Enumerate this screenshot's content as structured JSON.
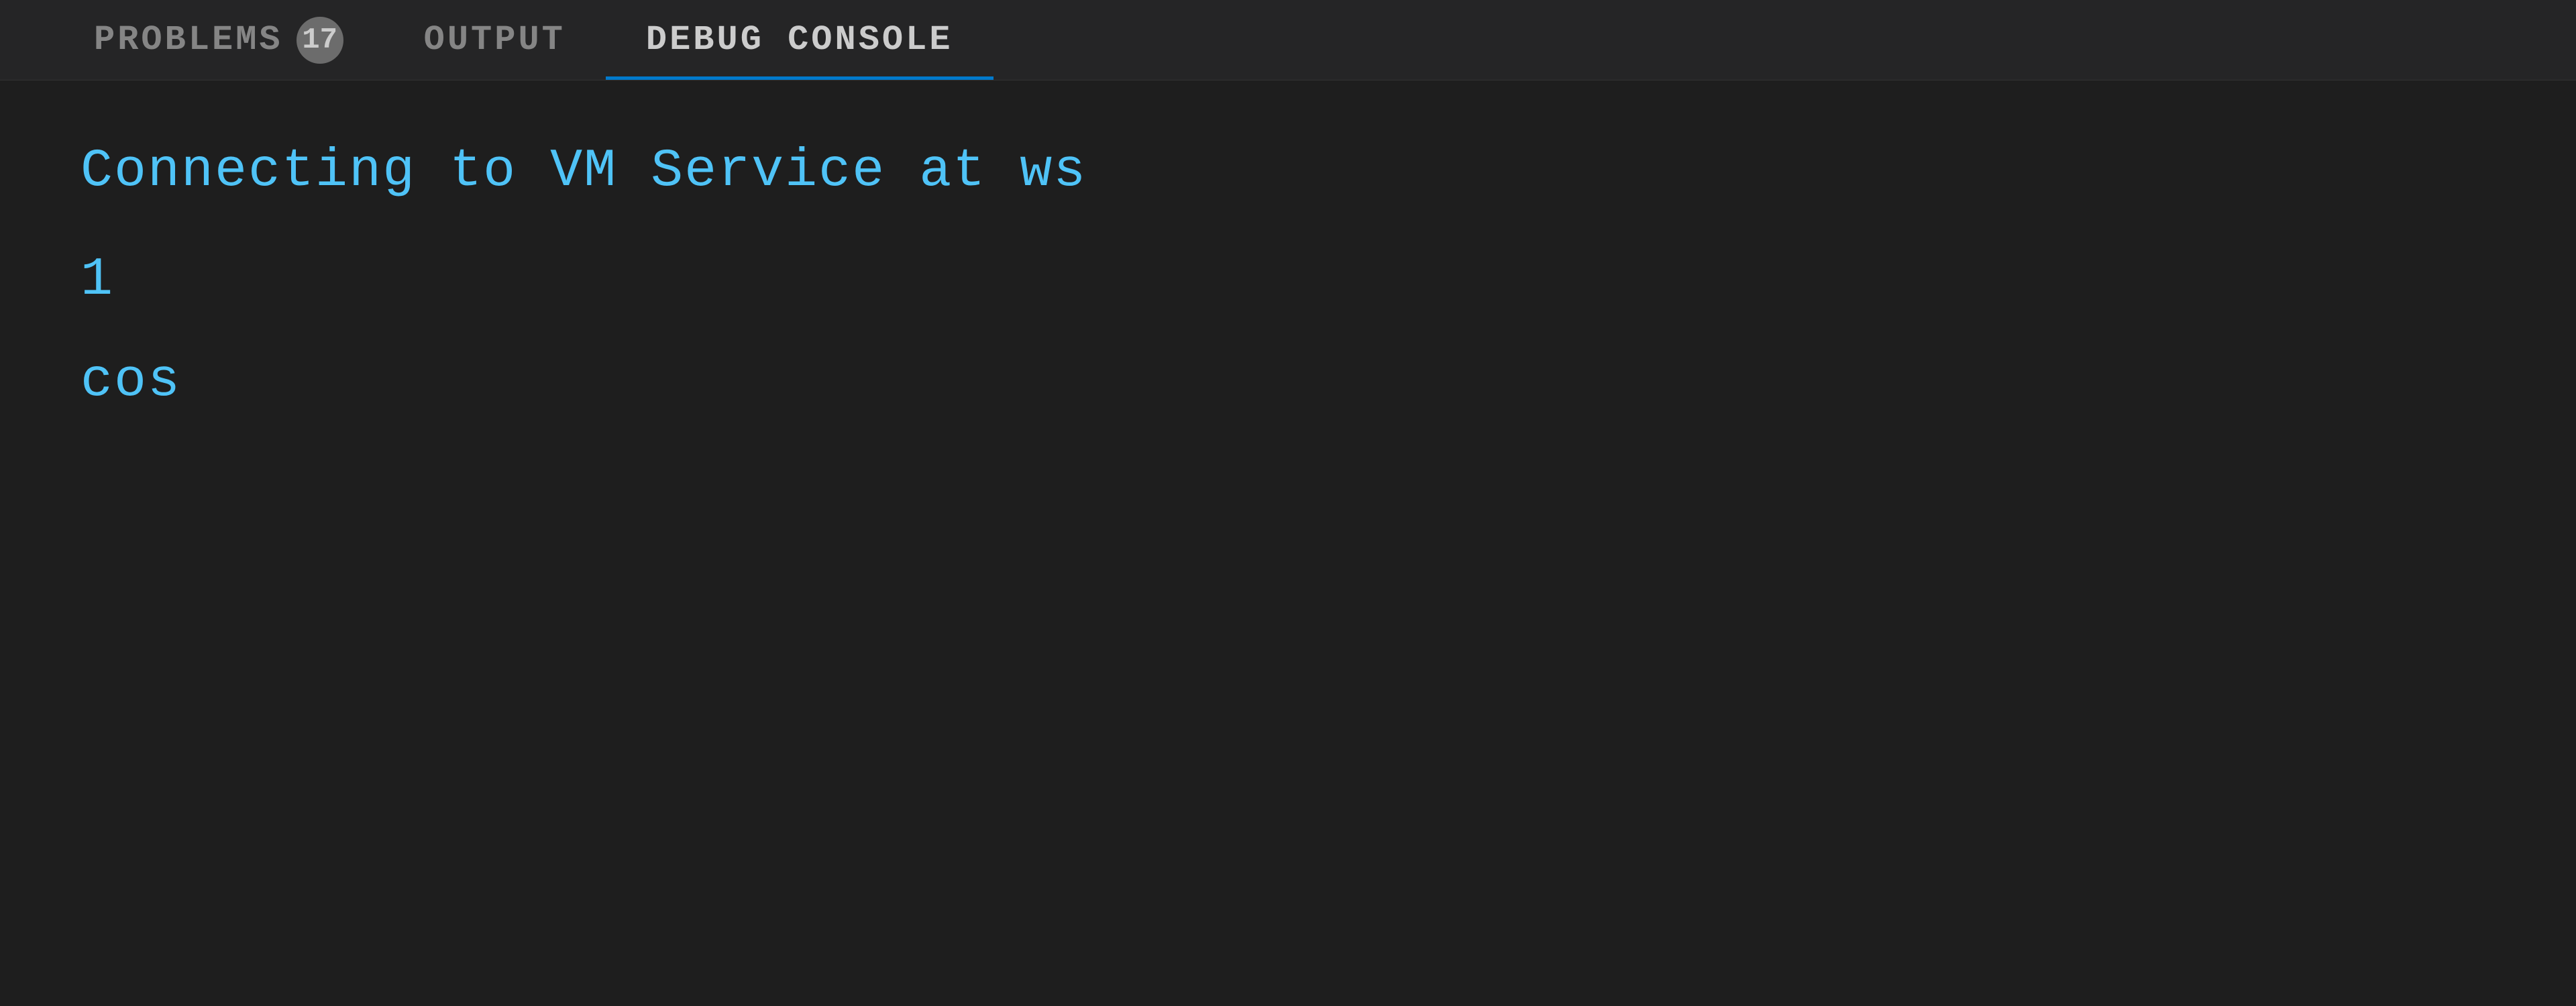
{
  "tabs": [
    {
      "id": "problems",
      "label": "PROBLEMS",
      "badge": "17",
      "active": false
    },
    {
      "id": "output",
      "label": "OUTPUT",
      "badge": null,
      "active": false
    },
    {
      "id": "debug-console",
      "label": "DEBUG CONSOLE",
      "badge": null,
      "active": true
    }
  ],
  "console": {
    "line1": "Connecting to VM Service at ws",
    "line2": "1",
    "line3": "cos"
  },
  "colors": {
    "active_tab_indicator": "#007acc",
    "tab_bg": "#252526",
    "content_bg": "#1e1e1e",
    "text_primary": "#4fc3f7",
    "text_dim": "#858585",
    "badge_bg": "#6c6c6c"
  }
}
